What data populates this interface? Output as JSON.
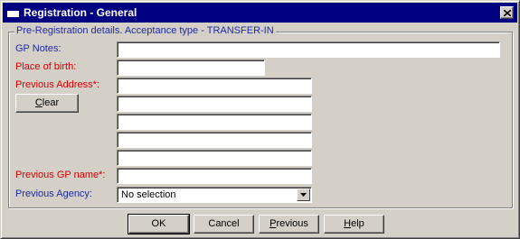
{
  "window": {
    "title": "Registration - General"
  },
  "group": {
    "legend": "Pre-Registration details. Acceptance type - TRANSFER-IN"
  },
  "fields": {
    "gp_notes_label": "GP Notes:",
    "place_of_birth_label": "Place of birth:",
    "previous_address_label": "Previous Address*:",
    "previous_gp_label": "Previous GP name*:",
    "previous_agency_label": "Previous Agency:",
    "gp_notes_value": "",
    "place_of_birth_value": "",
    "previous_gp_value": "",
    "address_lines": [
      "",
      "",
      "",
      "",
      ""
    ],
    "previous_agency_selected": "No selection"
  },
  "clear_button": {
    "first": "C",
    "rest": "lear"
  },
  "footer": {
    "ok": "OK",
    "cancel": "Cancel",
    "previous_first": "P",
    "previous_rest": "revious",
    "help_first": "H",
    "help_rest": "elp"
  },
  "colors": {
    "titlebar": "#000080",
    "label_blue": "#1f2aa6",
    "label_red": "#d40000",
    "face": "#d4d0c8"
  },
  "icons": {
    "window_icon": "window-icon",
    "close": "close-icon",
    "dropdown": "chevron-down-icon"
  }
}
